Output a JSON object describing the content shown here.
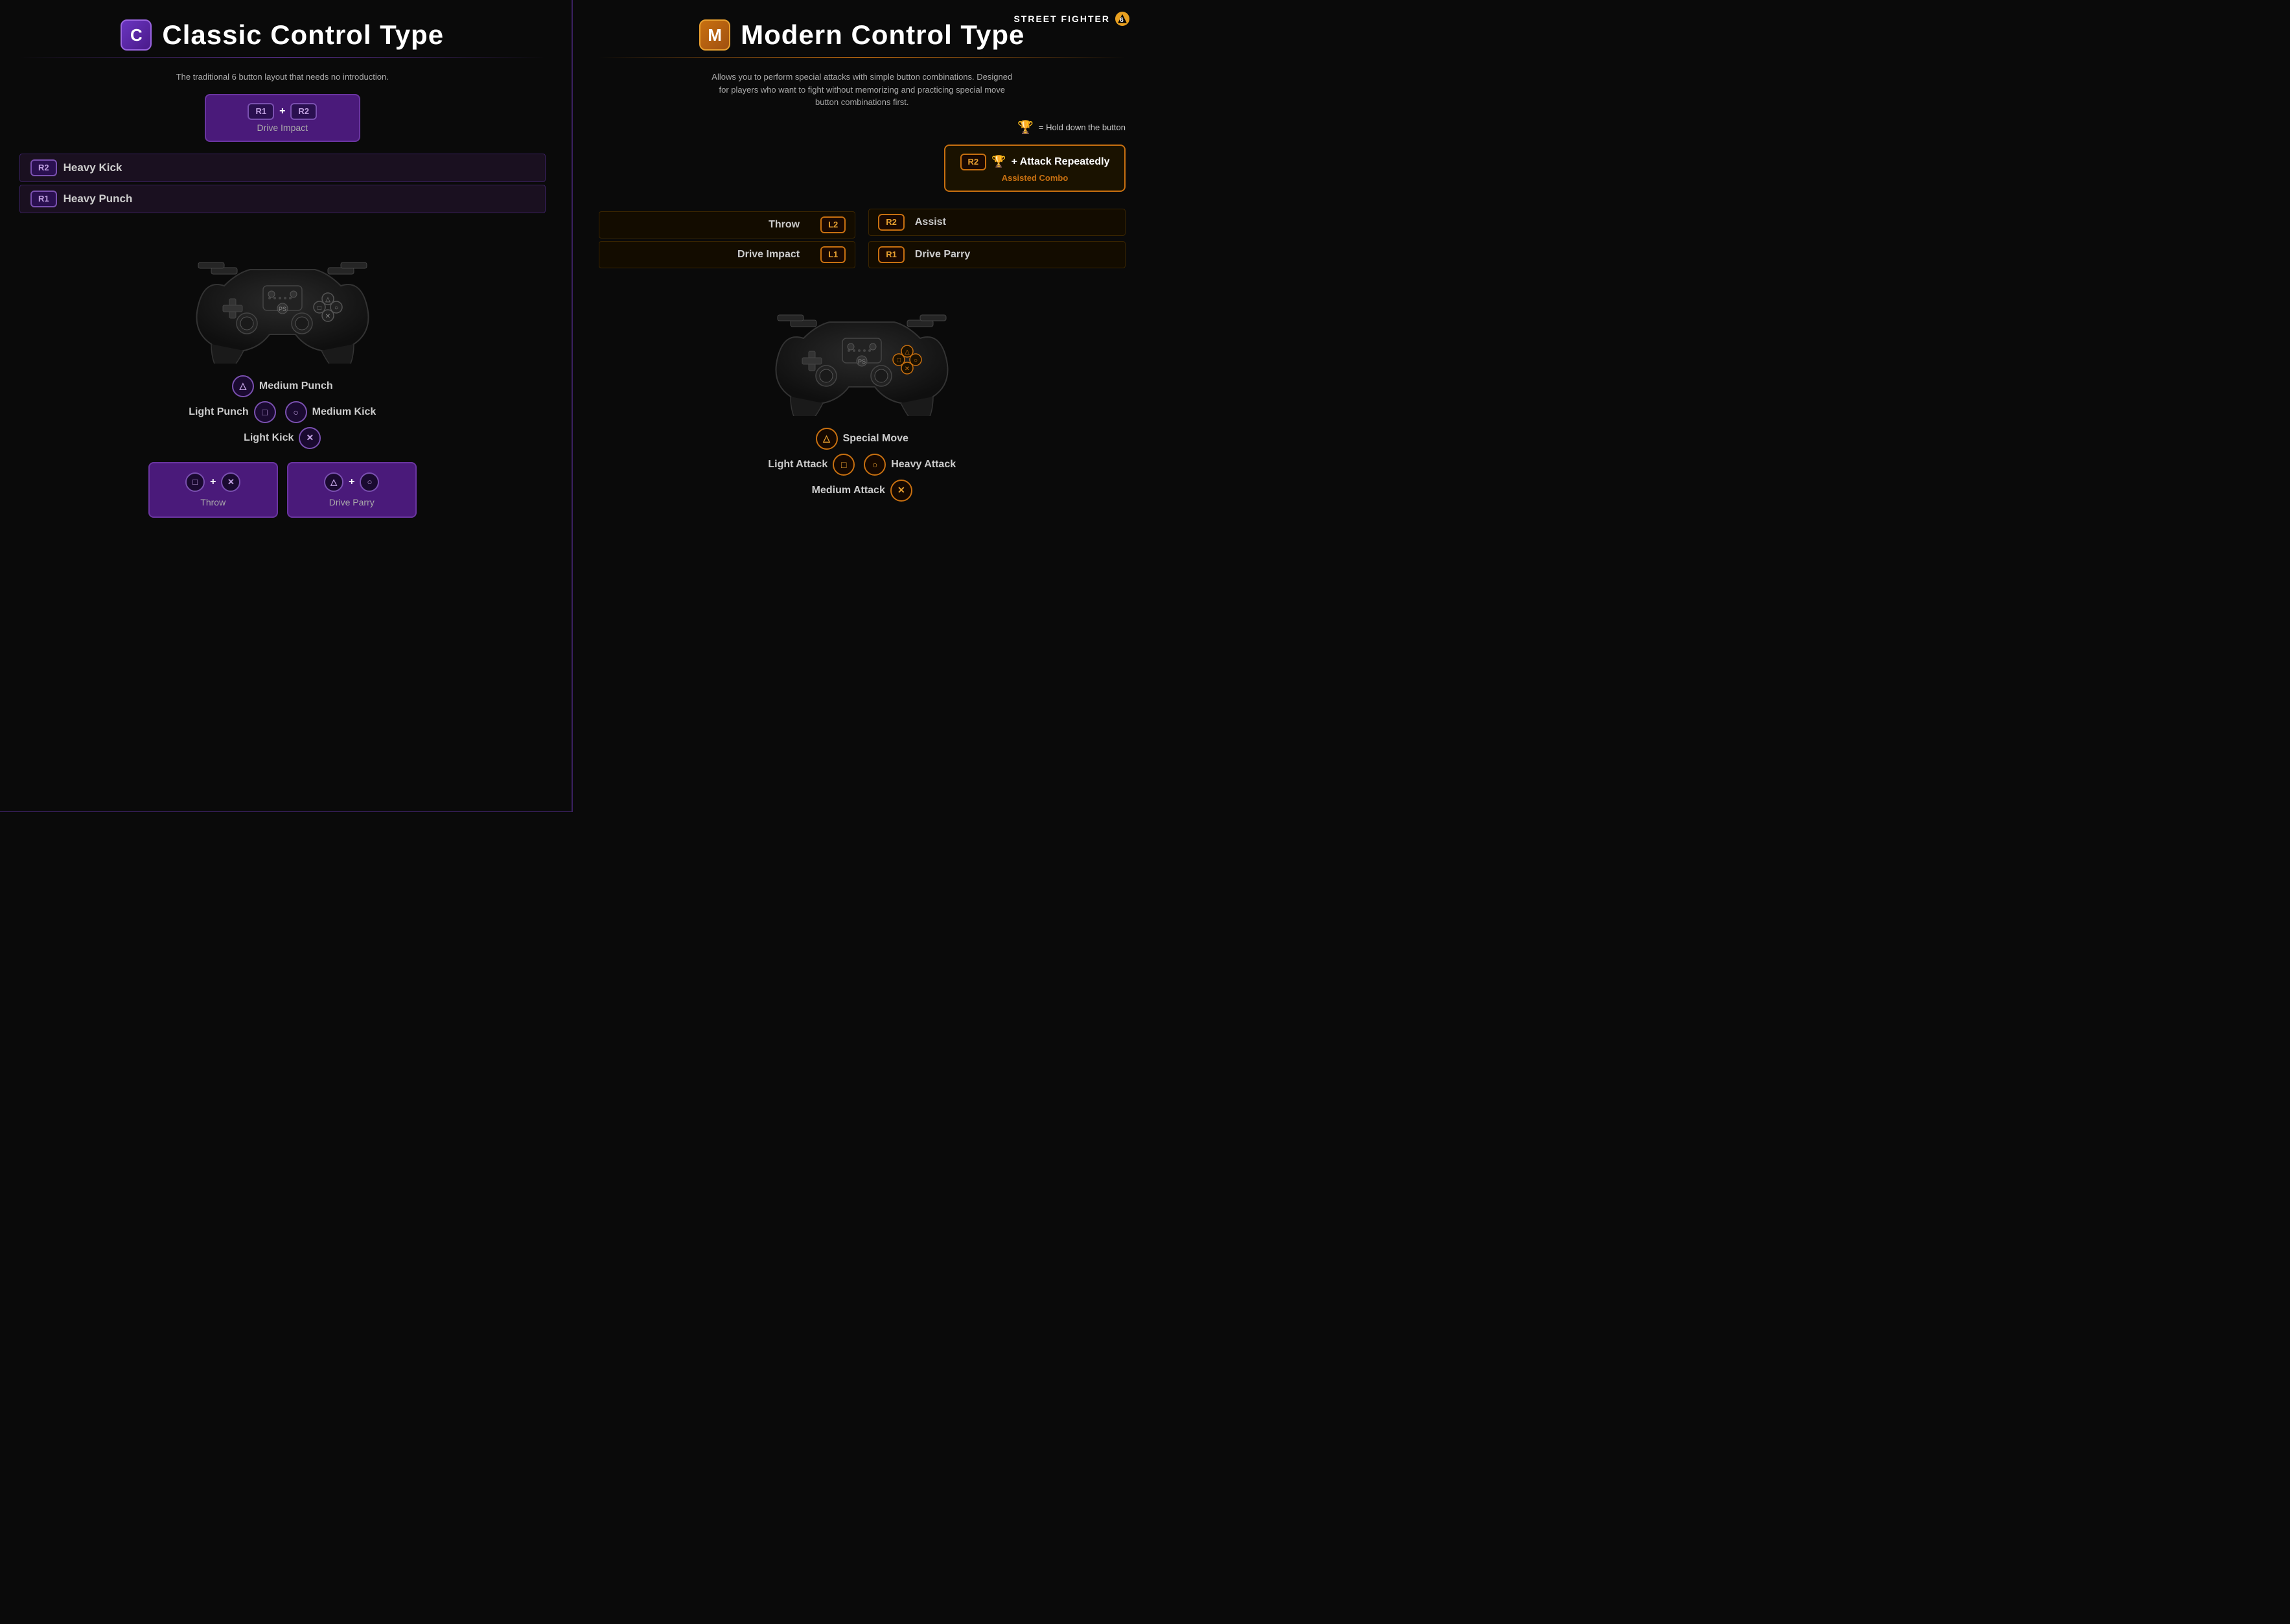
{
  "brand": {
    "name": "STREET FIGHTER",
    "icon": "6"
  },
  "classic": {
    "badge": "C",
    "title": "Classic Control Type",
    "description": "The traditional 6 button layout that needs no introduction.",
    "drive_impact_combo": {
      "btn1": "R1",
      "btn2": "R2",
      "label": "Drive Impact"
    },
    "trigger_controls": [
      {
        "badge": "R2",
        "label": "Heavy Kick"
      },
      {
        "badge": "R1",
        "label": "Heavy Punch"
      }
    ],
    "face_buttons": [
      {
        "row": "top",
        "icon": "△",
        "label": "Medium Punch"
      },
      {
        "left_label": "Light Punch",
        "left_icon": "□",
        "right_icon": "○",
        "right_label": "Medium Kick"
      },
      {
        "row": "bottom",
        "icon": "✕",
        "label": "Light Kick"
      }
    ],
    "combos": [
      {
        "icon1": "□",
        "icon2": "✕",
        "label": "Throw"
      },
      {
        "icon1": "△",
        "icon2": "○",
        "label": "Drive Parry"
      }
    ]
  },
  "modern": {
    "badge": "M",
    "title": "Modern Control Type",
    "description": "Allows you to perform special attacks with simple button combinations. Designed for players who want to fight without memorizing and practicing special move button combinations first.",
    "hold_note": "= Hold down the button",
    "assisted_combo": {
      "badge": "R2",
      "label": "+ Attack Repeatedly",
      "sub": "Assisted Combo"
    },
    "left_controls": [
      {
        "label": "Throw",
        "badge": "L2"
      },
      {
        "label": "Drive Impact",
        "badge": "L1"
      }
    ],
    "right_controls": [
      {
        "badge": "R2",
        "label": "Assist"
      },
      {
        "badge": "R1",
        "label": "Drive Parry"
      }
    ],
    "face_buttons": [
      {
        "row": "top",
        "icon": "△",
        "label": "Special Move"
      },
      {
        "left_label": "Light Attack",
        "left_icon": "□",
        "right_icon": "○",
        "right_label": "Heavy Attack"
      },
      {
        "row": "bottom",
        "icon": "✕",
        "label": "Medium Attack"
      }
    ]
  }
}
